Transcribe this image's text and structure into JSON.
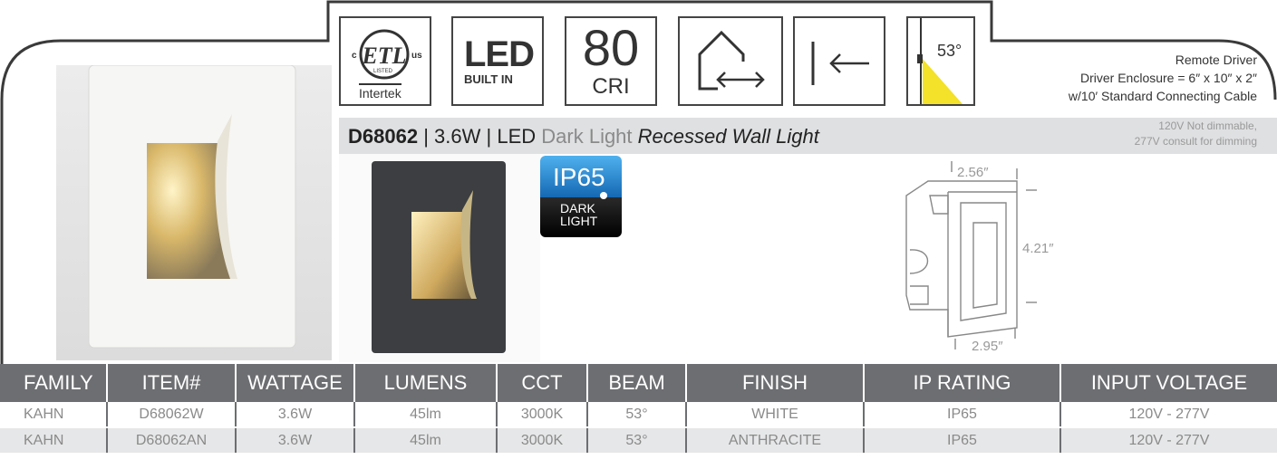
{
  "header": {
    "product_code": "D68062",
    "wattage": "3.6W",
    "desc_led": "LED",
    "desc_dark": "Dark Light",
    "desc_type": "Recessed Wall Light"
  },
  "icons": {
    "etl_c": "c",
    "etl_us": "us",
    "etl_listed": "LISTED",
    "etl_intertek": "Intertek",
    "led_big": "LED",
    "led_small": "BUILT IN",
    "cri_number": "80",
    "cri_label": "CRI",
    "beam_angle": "53°"
  },
  "driver": {
    "line1": "Remote Driver",
    "line2": "Driver Enclosure = 6″ x 10″ x 2″",
    "line3": "w/10′ Standard Connecting Cable"
  },
  "voltage_note": {
    "line1": "120V Not dimmable,",
    "line2": "277V consult for dimming"
  },
  "badge": {
    "ip": "IP65",
    "dark_line1": "DARK",
    "dark_line2": "LIGHT"
  },
  "dimensions": {
    "width_top": "2.56″",
    "height": "4.21″",
    "width_bottom": "2.95″"
  },
  "table": {
    "headers": [
      "FAMILY",
      "ITEM#",
      "WATTAGE",
      "LUMENS",
      "CCT",
      "BEAM",
      "FINISH",
      "IP RATING",
      "INPUT VOLTAGE"
    ],
    "rows": [
      [
        "KAHN",
        "D68062W",
        "3.6W",
        "45lm",
        "3000K",
        "53°",
        "WHITE",
        "IP65",
        "120V - 277V"
      ],
      [
        "KAHN",
        "D68062AN",
        "3.6W",
        "45lm",
        "3000K",
        "53°",
        "ANTHRACITE",
        "IP65",
        "120V - 277V"
      ]
    ]
  },
  "colors": {
    "header_bar": "#dfe0e2",
    "table_header": "#6d6e71",
    "ip_badge": "#1e88d6",
    "beam_yellow": "#f3e12a"
  }
}
